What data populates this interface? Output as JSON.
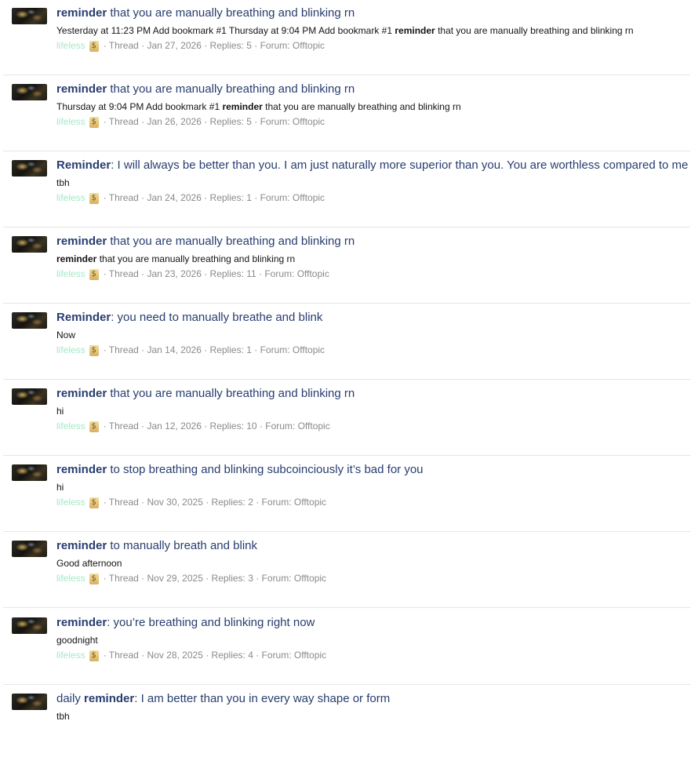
{
  "results": [
    {
      "title": [
        {
          "text": "reminder",
          "bold": true
        },
        {
          "text": " that you are manually breathing and blinking rn",
          "bold": false
        }
      ],
      "snippet": [
        {
          "text": "Yesterday at 11:23 PM Add bookmark #1 Thursday at 9:04 PM Add bookmark #1 ",
          "bold": false
        },
        {
          "text": "reminder",
          "bold": true
        },
        {
          "text": " that you are manually breathing and blinking rn",
          "bold": false
        }
      ],
      "user": "lifeless",
      "badge_icon": "$",
      "meta": "· Thread · Jan 27, 2026 · Replies: 5 · Forum: Offtopic"
    },
    {
      "title": [
        {
          "text": "reminder",
          "bold": true
        },
        {
          "text": " that you are manually breathing and blinking rn",
          "bold": false
        }
      ],
      "snippet": [
        {
          "text": "Thursday at 9:04 PM Add bookmark #1 ",
          "bold": false
        },
        {
          "text": "reminder",
          "bold": true
        },
        {
          "text": " that you are manually breathing and blinking rn",
          "bold": false
        }
      ],
      "user": "lifeless",
      "badge_icon": "$",
      "meta": "· Thread · Jan 26, 2026 · Replies: 5 · Forum: Offtopic"
    },
    {
      "title": [
        {
          "text": "Reminder",
          "bold": true
        },
        {
          "text": ": I will always be better than you. I am just naturally more superior than you. You are worthless compared to me",
          "bold": false
        }
      ],
      "snippet": [
        {
          "text": "tbh",
          "bold": false
        }
      ],
      "user": "lifeless",
      "badge_icon": "$",
      "meta": "· Thread · Jan 24, 2026 · Replies: 1 · Forum: Offtopic"
    },
    {
      "title": [
        {
          "text": "reminder",
          "bold": true
        },
        {
          "text": " that you are manually breathing and blinking rn",
          "bold": false
        }
      ],
      "snippet": [
        {
          "text": "reminder",
          "bold": true
        },
        {
          "text": " that you are manually breathing and blinking rn",
          "bold": false
        }
      ],
      "user": "lifeless",
      "badge_icon": "$",
      "meta": "· Thread · Jan 23, 2026 · Replies: 11 · Forum: Offtopic"
    },
    {
      "title": [
        {
          "text": "Reminder",
          "bold": true
        },
        {
          "text": ": you need to manually breathe and blink",
          "bold": false
        }
      ],
      "snippet": [
        {
          "text": "Now",
          "bold": false
        }
      ],
      "user": "lifeless",
      "badge_icon": "$",
      "meta": "· Thread · Jan 14, 2026 · Replies: 1 · Forum: Offtopic"
    },
    {
      "title": [
        {
          "text": "reminder",
          "bold": true
        },
        {
          "text": " that you are manually breathing and blinking rn",
          "bold": false
        }
      ],
      "snippet": [
        {
          "text": "hi",
          "bold": false
        }
      ],
      "user": "lifeless",
      "badge_icon": "$",
      "meta": "· Thread · Jan 12, 2026 · Replies: 10 · Forum: Offtopic"
    },
    {
      "title": [
        {
          "text": "reminder",
          "bold": true
        },
        {
          "text": " to stop breathing and blinking subcoinciously it’s bad for you",
          "bold": false
        }
      ],
      "snippet": [
        {
          "text": "hi",
          "bold": false
        }
      ],
      "user": "lifeless",
      "badge_icon": "$",
      "meta": "· Thread · Nov 30, 2025 · Replies: 2 · Forum: Offtopic"
    },
    {
      "title": [
        {
          "text": "reminder",
          "bold": true
        },
        {
          "text": " to manually breath and blink",
          "bold": false
        }
      ],
      "snippet": [
        {
          "text": "Good afternoon",
          "bold": false
        }
      ],
      "user": "lifeless",
      "badge_icon": "$",
      "meta": "· Thread · Nov 29, 2025 · Replies: 3 · Forum: Offtopic"
    },
    {
      "title": [
        {
          "text": "reminder",
          "bold": true
        },
        {
          "text": ": you’re breathing and blinking right now",
          "bold": false
        }
      ],
      "snippet": [
        {
          "text": "goodnight",
          "bold": false
        }
      ],
      "user": "lifeless",
      "badge_icon": "$",
      "meta": "· Thread · Nov 28, 2025 · Replies: 4 · Forum: Offtopic"
    },
    {
      "title": [
        {
          "text": "daily ",
          "bold": false
        },
        {
          "text": "reminder",
          "bold": true
        },
        {
          "text": ": I am better than you in every way shape or form",
          "bold": false
        }
      ],
      "snippet": [
        {
          "text": "tbh",
          "bold": false
        }
      ],
      "user": "",
      "badge_icon": "",
      "meta": ""
    }
  ]
}
